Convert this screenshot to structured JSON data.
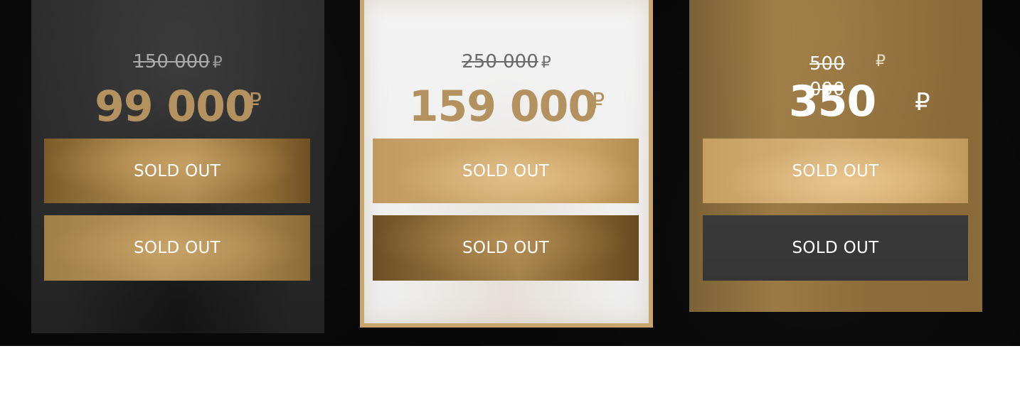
{
  "cards": [
    {
      "old_price": "150 000",
      "old_currency": "₽",
      "new_price": "99 000",
      "new_currency": "₽",
      "buttons": [
        "SOLD OUT",
        "SOLD OUT"
      ]
    },
    {
      "old_price": "250 000",
      "old_currency": "₽",
      "new_price": "159 000",
      "new_currency": "₽",
      "buttons": [
        "SOLD OUT",
        "SOLD OUT"
      ]
    },
    {
      "old_price": "500 000",
      "old_currency": "₽",
      "new_price": "350",
      "new_currency": "₽",
      "buttons": [
        "SOLD OUT",
        "SOLD OUT"
      ]
    }
  ],
  "colors": {
    "background": "#070707",
    "gold": "#b39260",
    "card_dark": "#2a2a2a",
    "card_light": "#efefef",
    "card_gold": "#8d6d3b",
    "button_charcoal": "#373737"
  }
}
